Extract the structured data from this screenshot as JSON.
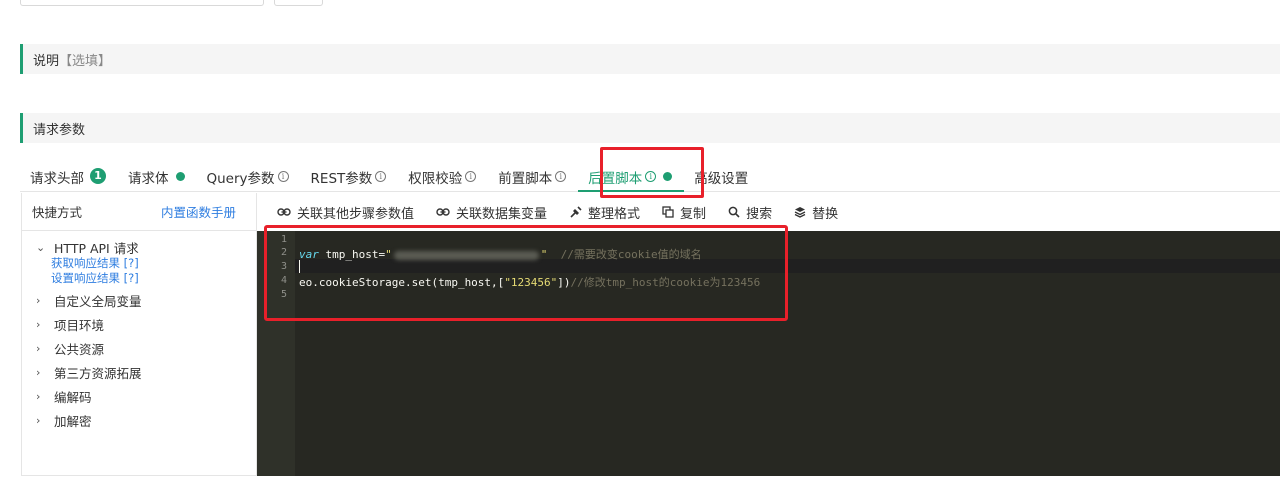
{
  "sections": {
    "description": {
      "title": "说明",
      "hint": "【选填】"
    },
    "request_params": {
      "title": "请求参数"
    }
  },
  "tabs": [
    {
      "label": "请求头部",
      "badge": "1"
    },
    {
      "label": "请求体"
    },
    {
      "label": "Query参数",
      "info": "i"
    },
    {
      "label": "REST参数",
      "info": "i"
    },
    {
      "label": "权限校验",
      "info": "i"
    },
    {
      "label": "前置脚本",
      "info": "i"
    },
    {
      "label": "后置脚本",
      "info": "i",
      "active": true
    },
    {
      "label": "高级设置"
    }
  ],
  "sidebar": {
    "title": "快捷方式",
    "manual_link": "内置函数手册",
    "tree": [
      {
        "label": "HTTP API 请求",
        "expanded": true,
        "children": [
          "获取响应结果 [?]",
          "设置响应结果 [?]"
        ]
      },
      {
        "label": "自定义全局变量"
      },
      {
        "label": "项目环境"
      },
      {
        "label": "公共资源"
      },
      {
        "label": "第三方资源拓展"
      },
      {
        "label": "编解码"
      },
      {
        "label": "加解密"
      }
    ]
  },
  "toolbar": {
    "link_step_params": "关联其他步骤参数值",
    "link_dataset_vars": "关联数据集变量",
    "format": "整理格式",
    "copy": "复制",
    "search": "搜索",
    "replace": "替换"
  },
  "editor": {
    "line_numbers": [
      "1",
      "2",
      "3",
      "4",
      "5"
    ],
    "line2": {
      "keyword": "var",
      "ident": " tmp_host=",
      "quote_open": "\"",
      "quote_close": "\"",
      "comment": "//需要改变cookie值的域名"
    },
    "line4": {
      "code": "eo.cookieStorage.set(tmp_host,[",
      "string": "\"123456\"",
      "code_end": "])",
      "comment": "//修改tmp_host的cookie为123456"
    }
  },
  "colors": {
    "accent": "#1e9e72",
    "link": "#2f7ee0",
    "highlight_box": "#e8202a",
    "editor_bg": "#272822"
  }
}
